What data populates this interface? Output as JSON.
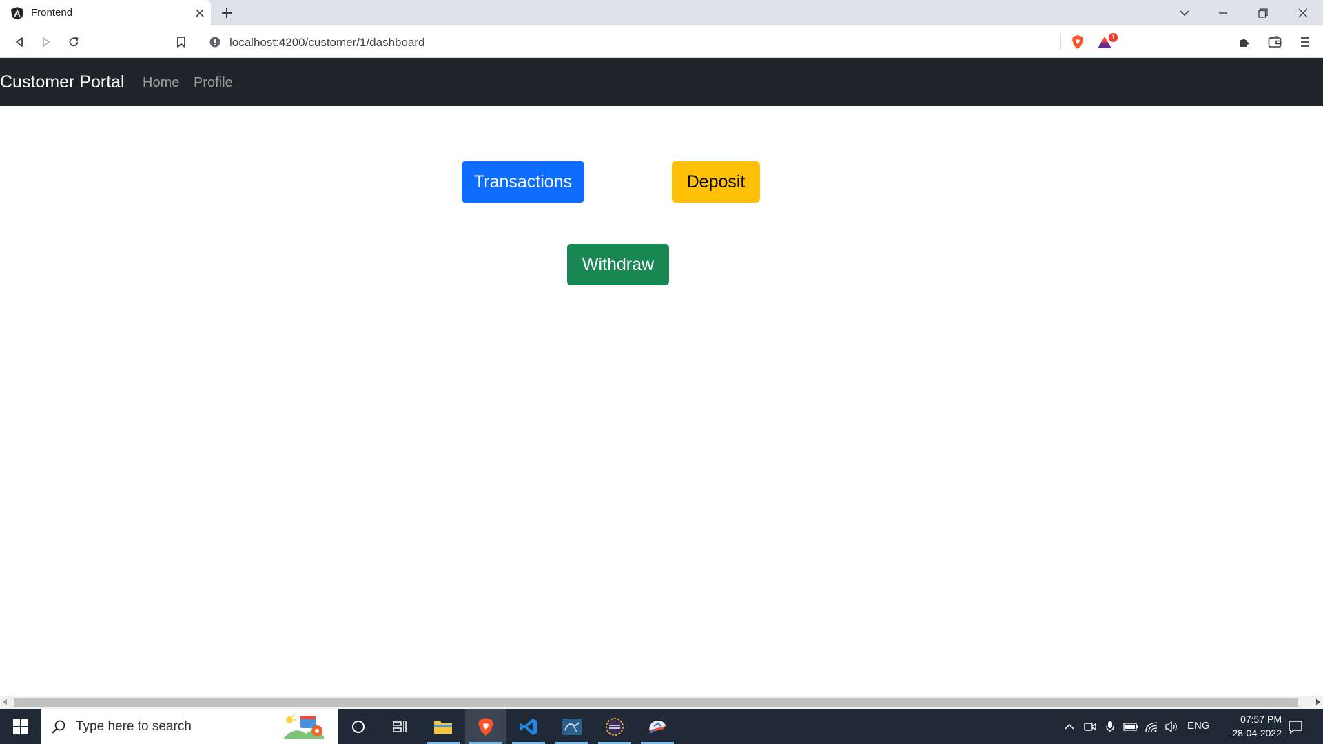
{
  "browser": {
    "tab": {
      "title": "Frontend",
      "favicon": "angular-logo-icon"
    },
    "address": {
      "url": "localhost:4200/customer/1/dashboard"
    },
    "notification_count": "1"
  },
  "app": {
    "brand": "Customer Portal",
    "nav": [
      {
        "label": "Home"
      },
      {
        "label": "Profile"
      }
    ],
    "buttons": {
      "transactions": "Transactions",
      "deposit": "Deposit",
      "withdraw": "Withdraw"
    },
    "colors": {
      "navbar": "#212529",
      "primary": "#0d6efd",
      "warning": "#ffc107",
      "success": "#198754"
    }
  },
  "taskbar": {
    "search_placeholder": "Type here to search",
    "language": "ENG",
    "time": "07:57 PM",
    "date": "28-04-2022",
    "pinned": [
      "task-view-icon",
      "file-explorer-icon",
      "brave-browser-icon",
      "vscode-icon",
      "mysql-workbench-icon",
      "eclipse-ide-icon",
      "postman-icon"
    ]
  }
}
